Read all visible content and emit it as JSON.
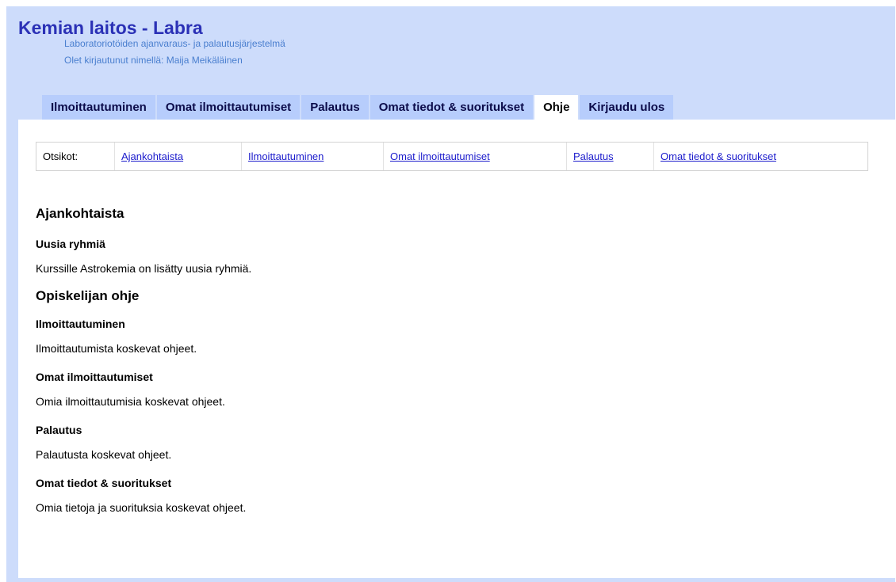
{
  "header": {
    "title": "Kemian laitos - Labra",
    "subtitle": "Laboratoriotöiden ajanvaraus- ja palautusjärjestelmä",
    "logged_in": "Olet kirjautunut nimellä: Maija Meikäläinen"
  },
  "tabs": [
    {
      "label": "Ilmoittautuminen",
      "active": false
    },
    {
      "label": "Omat ilmoittautumiset",
      "active": false
    },
    {
      "label": "Palautus",
      "active": false
    },
    {
      "label": "Omat tiedot & suoritukset",
      "active": false
    },
    {
      "label": "Ohje",
      "active": true
    },
    {
      "label": "Kirjaudu ulos",
      "active": false
    }
  ],
  "toc": {
    "label": "Otsikot:",
    "links": [
      "Ajankohtaista",
      "Ilmoittautuminen",
      "Omat ilmoittautumiset",
      "Palautus",
      "Omat tiedot & suoritukset"
    ]
  },
  "news": {
    "heading": "Ajankohtaista",
    "items": [
      {
        "title": "Uusia ryhmiä",
        "text": "Kurssille Astrokemia on lisätty uusia ryhmiä."
      }
    ]
  },
  "guide": {
    "heading": "Opiskelijan ohje",
    "sections": [
      {
        "title": "Ilmoittautuminen",
        "text": "Ilmoittautumista koskevat ohjeet."
      },
      {
        "title": "Omat ilmoittautumiset",
        "text": "Omia ilmoittautumisia koskevat ohjeet."
      },
      {
        "title": "Palautus",
        "text": "Palautusta koskevat ohjeet."
      },
      {
        "title": "Omat tiedot & suoritukset",
        "text": "Omia tietoja ja suorituksia koskevat ohjeet."
      }
    ]
  },
  "colors": {
    "header_bg": "#cddcfb",
    "tab_bg": "#b7cdfc",
    "title": "#2b31b6",
    "link": "#1b1bcc"
  }
}
